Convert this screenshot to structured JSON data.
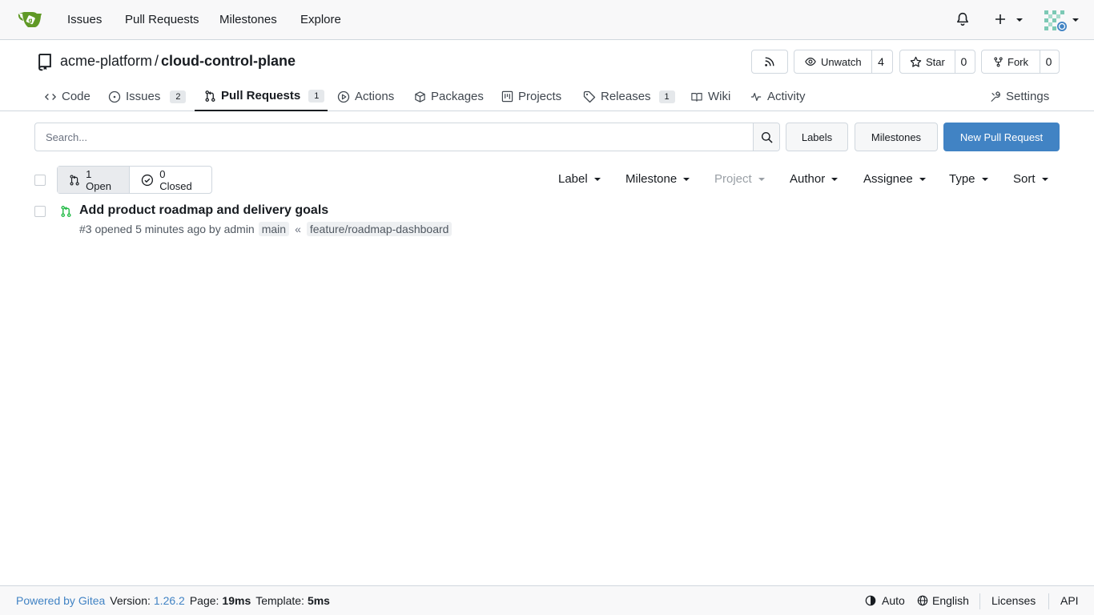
{
  "nav": {
    "links": [
      "Issues",
      "Pull Requests",
      "Milestones",
      "Explore"
    ]
  },
  "repo": {
    "owner": "acme-platform",
    "separator": "/",
    "name": "cloud-control-plane",
    "unwatch_label": "Unwatch",
    "watch_count": "4",
    "star_label": "Star",
    "star_count": "0",
    "fork_label": "Fork",
    "fork_count": "0"
  },
  "tabs": {
    "code": "Code",
    "issues": "Issues",
    "issues_count": "2",
    "pulls": "Pull Requests",
    "pulls_count": "1",
    "actions": "Actions",
    "packages": "Packages",
    "projects": "Projects",
    "releases": "Releases",
    "releases_count": "1",
    "wiki": "Wiki",
    "activity": "Activity",
    "settings": "Settings"
  },
  "toolbar": {
    "search_placeholder": "Search...",
    "labels_btn": "Labels",
    "milestones_btn": "Milestones",
    "new_pr_btn": "New Pull Request"
  },
  "states": {
    "open": "1 Open",
    "closed": "0 Closed"
  },
  "filters": {
    "label": "Label",
    "milestone": "Milestone",
    "project": "Project",
    "author": "Author",
    "assignee": "Assignee",
    "type": "Type",
    "sort": "Sort"
  },
  "pulls": [
    {
      "title": "Add product roadmap and delivery goals",
      "meta": "#3 opened 5 minutes ago by admin",
      "base_branch": "main",
      "arrow": "«",
      "head_branch": "feature/roadmap-dashboard"
    }
  ],
  "footer": {
    "powered": "Powered by Gitea",
    "version_label": "Version:",
    "version": "1.26.2",
    "page_label": "Page:",
    "page_time": "19ms",
    "template_label": "Template:",
    "template_time": "5ms",
    "theme": "Auto",
    "language": "English",
    "licenses": "Licenses",
    "api": "API"
  },
  "colors": {
    "primary": "#4183c4",
    "open_green": "#21ba45"
  }
}
